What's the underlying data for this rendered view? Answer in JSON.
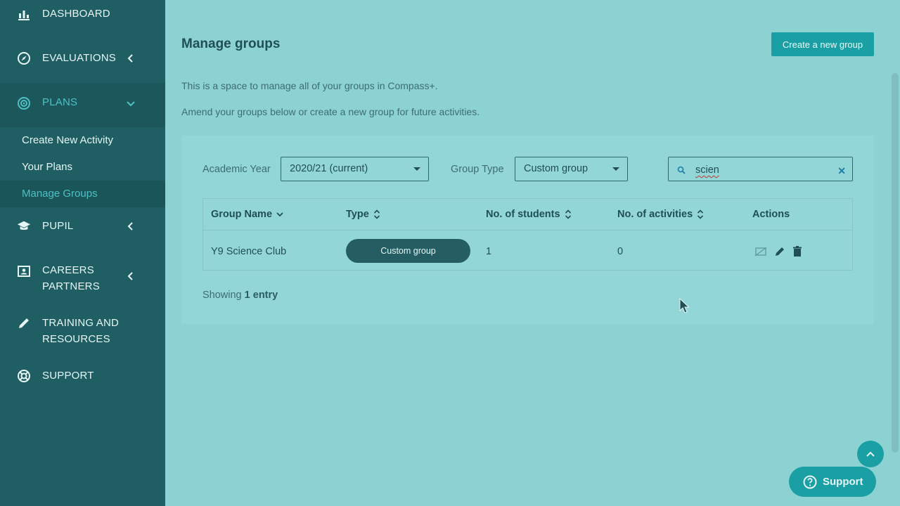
{
  "sidebar": {
    "dashboard": "DASHBOARD",
    "evaluations": "EVALUATIONS",
    "plans": "PLANS",
    "plans_sub": [
      "Create New Activity",
      "Your Plans",
      "Manage Groups"
    ],
    "pupil": "PUPIL",
    "careers_line1": "CAREERS",
    "careers_line2": "PARTNERS",
    "training_line1": "TRAINING AND",
    "training_line2": "RESOURCES",
    "support": "SUPPORT"
  },
  "main": {
    "title": "Manage groups",
    "create_button": "Create a new group",
    "desc1": "This is a space to manage all of your groups in Compass+.",
    "desc2": "Amend your groups below or create a new group for future activities.",
    "filters": {
      "academic_year_label": "Academic Year",
      "academic_year_value": "2020/21 (current)",
      "group_type_label": "Group Type",
      "group_type_value": "Custom group",
      "search_value": "scien"
    },
    "table": {
      "headers": [
        "Group Name",
        "Type",
        "No. of students",
        "No. of activities",
        "Actions"
      ],
      "rows": [
        {
          "name": "Y9 Science Club",
          "type": "Custom group",
          "students": "1",
          "activities": "0"
        }
      ]
    },
    "showing_prefix": "Showing",
    "showing_count": "1 entry"
  },
  "support_widget": "Support",
  "icons": [
    "dashboard-icon",
    "compass-icon",
    "target-icon",
    "graduation-cap-icon",
    "id-card-icon",
    "pencil-icon",
    "lifebuoy-icon",
    "search-icon",
    "clear-icon",
    "hide-icon",
    "edit-icon",
    "trash-icon",
    "chevron-up-icon",
    "question-icon"
  ],
  "colors": {
    "sidebar": "#1f5e62",
    "accent": "#1a9fa4",
    "background": "#8cd2d3",
    "active_text": "#4fc1c4"
  }
}
